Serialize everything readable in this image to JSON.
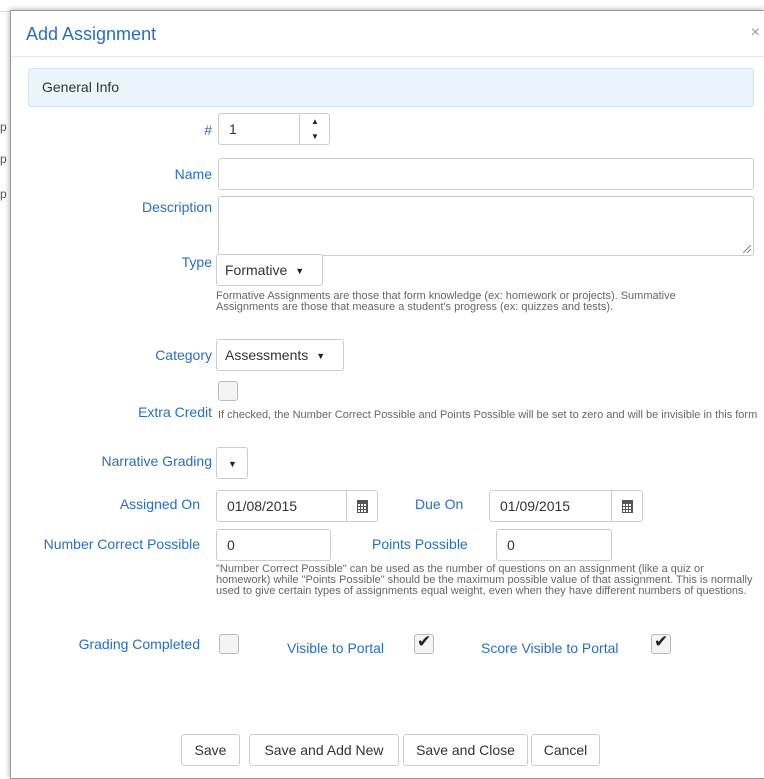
{
  "modal": {
    "title": "Add Assignment",
    "close": "×"
  },
  "section": {
    "title": "General Info"
  },
  "number": {
    "label": "#",
    "value": "1"
  },
  "name": {
    "label": "Name",
    "value": ""
  },
  "description": {
    "label": "Description",
    "value": ""
  },
  "type": {
    "label": "Type",
    "selected": "Formative",
    "help": "Formative Assignments are those that form knowledge (ex: homework or projects). Summative Assignments are those that measure a student's progress (ex: quizzes and tests)."
  },
  "category": {
    "label": "Category",
    "selected": "Assessments"
  },
  "extra_credit": {
    "label": "Extra Credit",
    "checked": false,
    "help": "If checked, the Number Correct Possible and Points Possible will be set to zero and will be invisible in this form"
  },
  "narrative_grading": {
    "label": "Narrative Grading",
    "selected": ""
  },
  "assigned_on": {
    "label": "Assigned On",
    "value": "01/08/2015"
  },
  "due_on": {
    "label": "Due On",
    "value": "01/09/2015"
  },
  "number_correct_possible": {
    "label": "Number Correct Possible",
    "value": "0"
  },
  "points_possible": {
    "label": "Points Possible",
    "value": "0"
  },
  "possible_help": "\"Number Correct Possible\" can be used as the number of questions on an assignment (like a quiz or homework) while \"Points Possible\" should be the maximum possible value of that assignment. This is normally used to give certain types of assignments equal weight, even when they have different numbers of questions.",
  "grading_completed": {
    "label": "Grading Completed",
    "checked": false
  },
  "visible_to_portal": {
    "label": "Visible to Portal",
    "checked": true
  },
  "score_visible_to_portal": {
    "label": "Score Visible to Portal",
    "checked": true
  },
  "buttons": {
    "save": "Save",
    "save_add_new": "Save and Add New",
    "save_close": "Save and Close",
    "cancel": "Cancel"
  },
  "icons": {
    "spin_up": "▲",
    "spin_down": "▼",
    "caret": "▼",
    "check": "✔"
  }
}
